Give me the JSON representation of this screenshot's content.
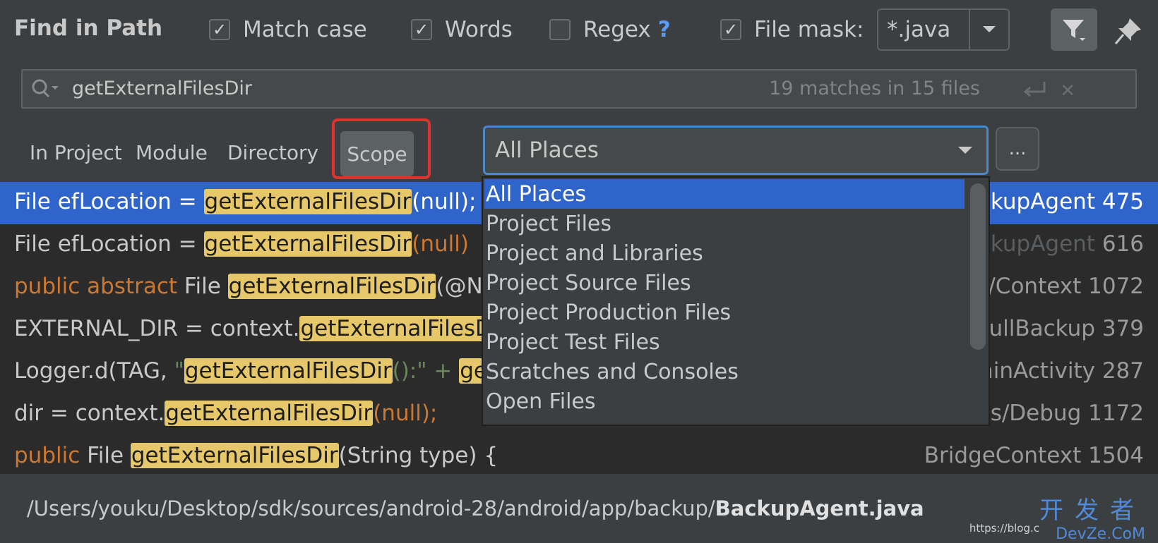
{
  "header": {
    "title": "Find in Path",
    "options": [
      {
        "label": "Match case",
        "checked": true
      },
      {
        "label": "Words",
        "checked": true
      },
      {
        "label": "Regex",
        "checked": false,
        "help": "?"
      },
      {
        "label": "File mask:",
        "checked": true
      }
    ],
    "file_mask_value": "*.java"
  },
  "search": {
    "query": "getExternalFilesDir",
    "count": "19 matches in 15 files"
  },
  "scope": {
    "tabs": [
      "In Project",
      "Module",
      "Directory",
      "Scope"
    ],
    "selected_tab": "Scope",
    "dropdown_value": "All Places",
    "more_label": "...",
    "popup_items": [
      "All Places",
      "Project Files",
      "Project and Libraries",
      "Project Source Files",
      "Project Production Files",
      "Project Test Files",
      "Scratches and Consoles",
      "Open Files"
    ]
  },
  "results": [
    {
      "pre": "File efLocation = ",
      "match": "getExternalFilesDir",
      "post": "(null);",
      "loc_dim": "",
      "loc": "ckupAgent 475"
    },
    {
      "pre": "File efLocation = ",
      "match": "getExternalFilesDir",
      "post": "(null)",
      "loc_dim": "ckupAgent",
      "loc": " 616"
    },
    {
      "pre": "public abstract ",
      "pre2": "File ",
      "match": "getExternalFilesDir",
      "post": "(@N",
      "loc_dim": "",
      "loc": "/Context 1072"
    },
    {
      "pre": "EXTERNAL_DIR = context.",
      "match": "getExternalFilesD",
      "post": "",
      "loc_dim": "",
      "loc": "FullBackup 379"
    },
    {
      "pre": "Logger.d(TAG, ",
      "str": "\"",
      "match": "getExternalFilesDir",
      "post": "():\" + ",
      "match2": "ge",
      "loc_dim": "",
      "loc": "ainActivity 287"
    },
    {
      "pre": "dir = context.",
      "match": "getExternalFilesDir",
      "post": "(null);",
      "loc_dim": "",
      "loc": "os/Debug 1172"
    },
    {
      "pre": "public ",
      "pre2": "File ",
      "match": "getExternalFilesDir",
      "post": "(String type) {",
      "loc_dim": "",
      "loc": "BridgeContext 1504"
    }
  ],
  "footer": {
    "path_prefix": "/Users/youku/Desktop/sdk/sources/android-28/android/app/backup/",
    "path_file": "BackupAgent.java"
  },
  "watermark": {
    "cn": "开发者",
    "en": "DevZe.CoM",
    "url": "https://blog.c"
  },
  "colors": {
    "background": "#3c3f41",
    "results_bg": "#2b2b2b",
    "selection": "#2f65ca",
    "match_highlight": "#e6c86a",
    "keyword": "#cc7832",
    "scope_outline": "#e0312c",
    "focus_border": "#4a88c7"
  },
  "icons": [
    "search-icon",
    "filter-icon",
    "pin-icon",
    "enter-icon",
    "close-icon",
    "chevron-down-icon"
  ]
}
